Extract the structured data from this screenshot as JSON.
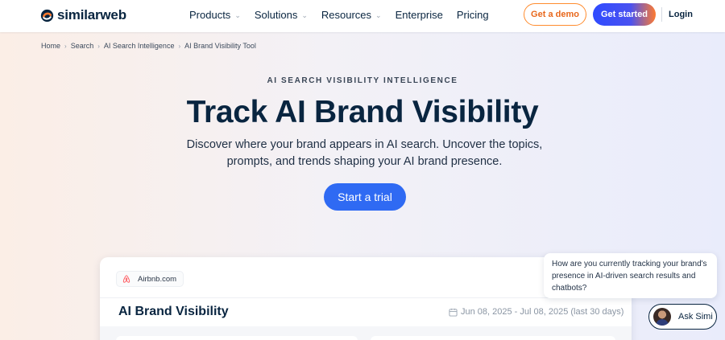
{
  "header": {
    "brand": "similarweb",
    "nav": [
      {
        "label": "Products",
        "chevron": true
      },
      {
        "label": "Solutions",
        "chevron": true
      },
      {
        "label": "Resources",
        "chevron": true
      },
      {
        "label": "Enterprise",
        "chevron": false
      },
      {
        "label": "Pricing",
        "chevron": false
      }
    ],
    "demo_label": "Get a demo",
    "started_label": "Get started",
    "login_label": "Login"
  },
  "breadcrumb": [
    "Home",
    "Search",
    "AI Search Intelligence",
    "AI Brand Visibility Tool"
  ],
  "hero": {
    "eyebrow": "AI SEARCH VISIBILITY INTELLIGENCE",
    "title": "Track AI Brand Visibility",
    "subtitle": "Discover where your brand appears in AI search. Uncover the topics, prompts, and trends shaping your AI brand presence.",
    "cta": "Start a trial"
  },
  "preview": {
    "site": "Airbnb.com",
    "title": "AI Brand Visibility",
    "date_range": "Jun 08, 2025 - Jul 08, 2025 (last 30 days)"
  },
  "chat": {
    "message": "How are you currently tracking your brand's presence in AI-driven search results and chatbots?",
    "button": "Ask Simi"
  },
  "colors": {
    "brand_navy": "#092540",
    "cta_blue": "#2f6af3",
    "demo_orange": "#ff8c2e",
    "airbnb": "#ff5a5f"
  },
  "icons": [
    "similarweb-logo-icon",
    "chevron-down-icon",
    "chevron-right-icon",
    "airbnb-icon",
    "calendar-icon",
    "avatar"
  ]
}
